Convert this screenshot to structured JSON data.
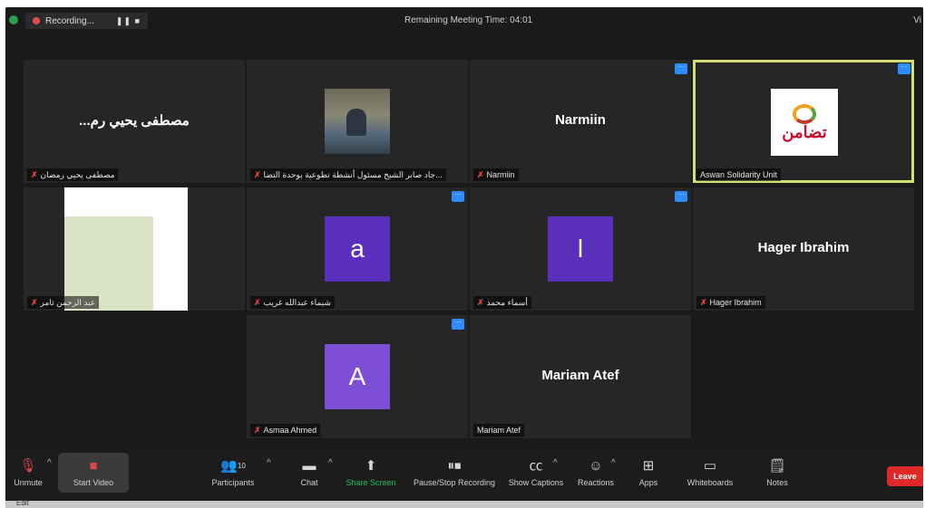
{
  "topbar": {
    "recording_label": "Recording...",
    "recording_controls": "❚❚ ■",
    "remaining_time": "Remaining Meeting Time: 04:01",
    "view_label": "Vi"
  },
  "tiles": {
    "t1": {
      "center_name": "...مصطفى يحيي رم",
      "tag": "مصطفى يحيي رمضان"
    },
    "t2": {
      "tag": "جاد صابر الشيخ مسئول أنشطة تطوعية بوحدة التضا..."
    },
    "t3": {
      "center_name": "Narmiin",
      "tag": "Narmiin"
    },
    "t4": {
      "tag": "Aswan Solidarity Unit",
      "logo_text": "تضامن"
    },
    "t5": {
      "tag": "عبد الرحمن ثامر"
    },
    "t6": {
      "avatar_letter": "a",
      "avatar_color": "#5b2fbd",
      "tag": "شيماء عبدالله غريب"
    },
    "t7": {
      "avatar_letter": "l",
      "avatar_color": "#5b2fbd",
      "tag": "أسماء محمد"
    },
    "t8": {
      "center_name": "Hager Ibrahim",
      "tag": "Hager Ibrahim"
    },
    "t9": {
      "avatar_letter": "A",
      "avatar_color": "#7c4fd6",
      "tag": "Asmaa Ahmed"
    },
    "t10": {
      "center_name": "Mariam Atef",
      "tag": "Mariam Atef"
    }
  },
  "toolbar": {
    "unmute": "Unmute",
    "start_video": "Start Video",
    "participants": "Participants",
    "participants_count": "10",
    "chat": "Chat",
    "share_screen": "Share Screen",
    "pause_stop_recording": "Pause/Stop Recording",
    "show_captions": "Show Captions",
    "reactions": "Reactions",
    "apps": "Apps",
    "whiteboards": "Whiteboards",
    "notes": "Notes",
    "leave": "Leave"
  },
  "taskbar": {
    "left_text": "Edit"
  },
  "colors": {
    "active_border": "#d5de73",
    "more_button": "#2d8cff",
    "leave": "#e02828",
    "share_green": "#1fc157"
  }
}
